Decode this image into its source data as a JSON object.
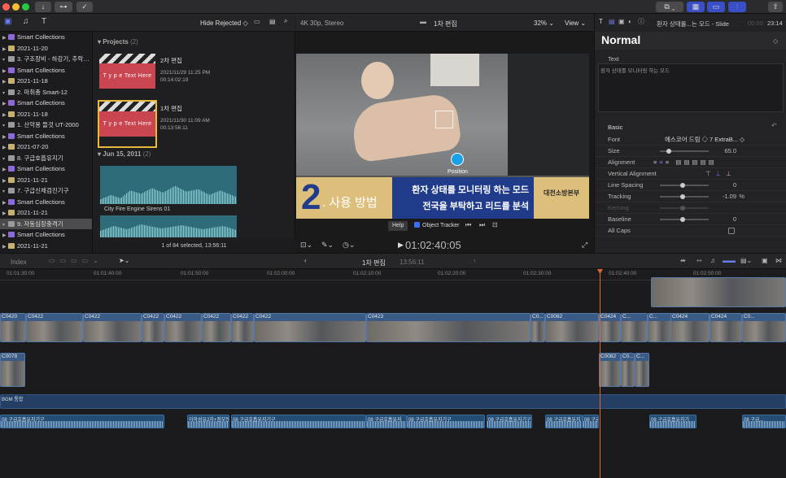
{
  "library": {
    "hide_rejected": "Hide Rejected ◇",
    "items": [
      {
        "label": "Smart Collections",
        "level": 1,
        "type": "smart"
      },
      {
        "label": "2021-11-20",
        "level": 1,
        "type": "event"
      },
      {
        "label": "3. 구조장비 - 하강기, 추락…",
        "level": 0,
        "type": "lib"
      },
      {
        "label": "Smart Collections",
        "level": 1,
        "type": "smart"
      },
      {
        "label": "2021-11-18",
        "level": 1,
        "type": "event"
      },
      {
        "label": "2. 마취총 Smart-12",
        "level": 0,
        "type": "lib"
      },
      {
        "label": "Smart Collections",
        "level": 1,
        "type": "smart"
      },
      {
        "label": "2021-11-18",
        "level": 1,
        "type": "event"
      },
      {
        "label": "1. 산악용 들것 UT-2000",
        "level": 0,
        "type": "lib"
      },
      {
        "label": "Smart Collections",
        "level": 1,
        "type": "smart"
      },
      {
        "label": "2021-07-20",
        "level": 1,
        "type": "event"
      },
      {
        "label": "8. 구급호흡유지기",
        "level": 0,
        "type": "lib"
      },
      {
        "label": "Smart Collections",
        "level": 1,
        "type": "smart"
      },
      {
        "label": "2021-11-21",
        "level": 1,
        "type": "event"
      },
      {
        "label": "7. 구급신체검진기구",
        "level": 0,
        "type": "lib"
      },
      {
        "label": "Smart Collections",
        "level": 1,
        "type": "smart"
      },
      {
        "label": "2021-11-21",
        "level": 1,
        "type": "event"
      },
      {
        "label": "9. 자동심장충격기",
        "level": 0,
        "type": "lib",
        "selected": true
      },
      {
        "label": "Smart Collections",
        "level": 1,
        "type": "smart"
      },
      {
        "label": "2021-11-21",
        "level": 1,
        "type": "event"
      }
    ]
  },
  "browser": {
    "projects_header": "Projects",
    "projects_count": "(2)",
    "projects": [
      {
        "title": "2차 편집",
        "date": "2021/11/29 11:25 PM",
        "duration": "00:14:02:19",
        "thumb": "T y p e  Text Here"
      },
      {
        "title": "1차 편집",
        "date": "2021/11/30 11:09 AM",
        "duration": "00:13:56:11",
        "thumb": "T y p e  Text Here"
      }
    ],
    "event_header": "Jun 15, 2011",
    "event_count": "(2)",
    "audio_clip": "City Fire Engine Sirens 01",
    "footer": "1 of 84 selected, 13:56:11"
  },
  "viewer": {
    "format": "4K 30p, Stereo",
    "title": "1차 편집",
    "zoom": "32%",
    "view": "View",
    "caption_number": "2",
    "caption_title": ". 사용 방법",
    "caption_line1": "환자 상태를 모니터링 하는 모드",
    "caption_line2": "전국을 부탁하고 리드를 분석",
    "logo_text": "대전소방본부",
    "position_label": "Position",
    "help": "Help",
    "object_tracker": "Object Tracker",
    "timecode": "01:02:40:05"
  },
  "inspector": {
    "header_title": "환자 상태를...는 모드 - Slide",
    "header_time": "23:14",
    "header_time_dim": "00:00:",
    "style": "Normal",
    "text_label": "Text",
    "text_value": "환자 상태를 모니터링 하는 모드",
    "basic_label": "Basic",
    "font_label": "Font",
    "font_family": "에스코어 드림",
    "font_weight": "7 ExtraB...",
    "size_label": "Size",
    "size_value": "65.0",
    "alignment_label": "Alignment",
    "valign_label": "Vertical Alignment",
    "line_spacing_label": "Line Spacing",
    "line_spacing_value": "0",
    "tracking_label": "Tracking",
    "tracking_value": "-1.09",
    "tracking_unit": "%",
    "kerning_label": "Kerning",
    "baseline_label": "Baseline",
    "baseline_value": "0",
    "allcaps_label": "All Caps"
  },
  "timeline": {
    "index": "Index",
    "project": "1차 편집",
    "duration": "13:56:11",
    "ruler": [
      "01:01:30:00",
      "01:01:40:00",
      "01:01:50:00",
      "01:02:00:00",
      "01:02:10:00",
      "01:02:20:00",
      "01:02:30:00",
      "01:02:40:00",
      "01:02:50:00"
    ],
    "video_clips": [
      "C0420",
      "C0422",
      "C0422",
      "C0422",
      "C0422",
      "C0422",
      "C0422",
      "C0422",
      "C0423",
      "C0...",
      "C0082",
      "C0424",
      "C...",
      "C...",
      "C0424",
      "C0424",
      "C0..."
    ],
    "lower_clips": [
      "C0078",
      "C0082",
      "C0...",
      "C..."
    ],
    "bgm_label": "BGM 통합",
    "audio_clips": [
      "08 구급호흡유지기구",
      "이마성유2차+정부분",
      "08 구급호흡유지기구",
      "08 구급호흡유지",
      "08 구급호흡유지기구",
      "08 구급호흡유지기구",
      "08 구급호흡유지",
      "08 구급호흡...",
      "08 구급호흡유지기",
      "08 구급..."
    ]
  }
}
